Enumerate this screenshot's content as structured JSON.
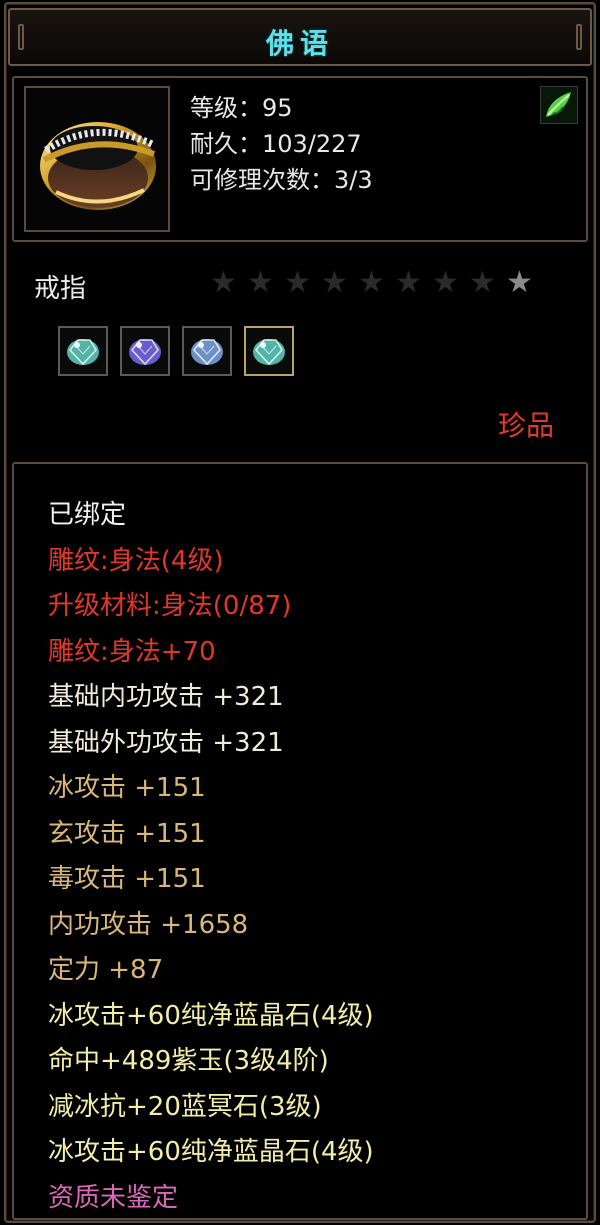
{
  "title": "佛语",
  "item": {
    "level_line": "等级：95",
    "durability_line": "耐久：103/227",
    "repair_line": "可修理次数：3/3",
    "type": "戒指",
    "rarity": "珍品",
    "icon": "gold-ring-icon",
    "badge_icon": "green-leaf-icon"
  },
  "stars": {
    "total": 9,
    "lit": 1
  },
  "gems": [
    {
      "name": "cyan-gem-icon",
      "color": "#5fd4c4",
      "selected": false
    },
    {
      "name": "purple-gem-icon",
      "color": "#7a6cf0",
      "selected": false
    },
    {
      "name": "blue-gem-icon",
      "color": "#7fa8e8",
      "selected": false
    },
    {
      "name": "cyan-gem-icon",
      "color": "#5fd4c4",
      "selected": true
    }
  ],
  "attributes": [
    {
      "text": "已绑定",
      "tone": "white"
    },
    {
      "text": "雕纹:身法(4级)",
      "tone": "red"
    },
    {
      "text": "升级材料:身法(0/87)",
      "tone": "red"
    },
    {
      "text": "雕纹:身法+70",
      "tone": "red"
    },
    {
      "text": "基础内功攻击  +321",
      "tone": "cream"
    },
    {
      "text": "基础外功攻击  +321",
      "tone": "cream"
    },
    {
      "text": "冰攻击  +151",
      "tone": "tan"
    },
    {
      "text": "玄攻击  +151",
      "tone": "tan"
    },
    {
      "text": "毒攻击  +151",
      "tone": "tan"
    },
    {
      "text": "内功攻击  +1658",
      "tone": "tan"
    },
    {
      "text": "定力  +87",
      "tone": "tan"
    },
    {
      "text": "冰攻击+60纯净蓝晶石(4级)",
      "tone": "yellow"
    },
    {
      "text": "命中+489紫玉(3级4阶)",
      "tone": "yellow"
    },
    {
      "text": "减冰抗+20蓝冥石(3级)",
      "tone": "yellow"
    },
    {
      "text": "冰攻击+60纯净蓝晶石(4级)",
      "tone": "yellow"
    },
    {
      "text": "资质未鉴定",
      "tone": "pink"
    }
  ],
  "colors": {
    "title": "#5ee0e8",
    "rarity": "#e13a2c",
    "border": "#5a4b3c"
  }
}
